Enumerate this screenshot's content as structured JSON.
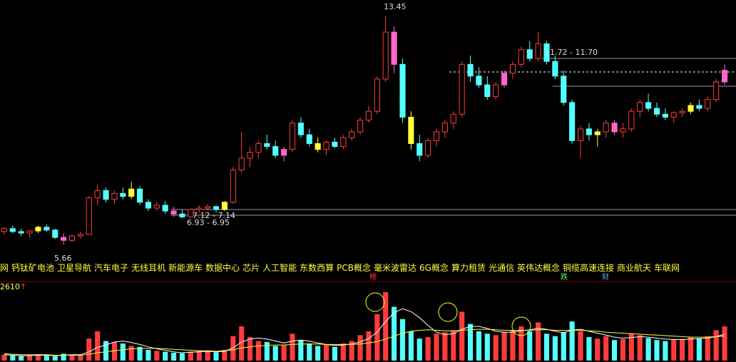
{
  "colors": {
    "background": "#000000",
    "up": "#ff3c3c",
    "down": "#54ffff",
    "highlight_yellow": "#ffff3c",
    "highlight_pink": "#ff66cc",
    "dash_line": "#ffffff",
    "concept_text": "#ffff3c",
    "ma_line": "#ffff3c",
    "ma_line2": "#ffffff"
  },
  "price_annotations": {
    "high": "13.45",
    "low": "5.66",
    "range_top": "11.72 - 11.70",
    "range_mid1": "7.12 - 7.14",
    "range_mid2": "6.93 - 6.95"
  },
  "concepts": [
    "网",
    "钙钛矿电池",
    "卫星导航",
    "汽车电子",
    "无线耳机",
    "新能源车",
    "数据中心",
    "芯片",
    "人工智能",
    "东数西算",
    "PCB概念",
    "毫米波雷达",
    "6G概念",
    "算力租赁",
    "光通信",
    "英伟达概念",
    "铜缆高速连接",
    "商业航天",
    "车联网"
  ],
  "volume_label": "2610",
  "volume_arrow": "↑",
  "event_tags": [
    {
      "text": "榜",
      "color": "#ff3c3c"
    },
    {
      "text": "跌",
      "color": "#54ff54"
    },
    {
      "text": "财",
      "color": "#54a8ff"
    }
  ],
  "chart_data": {
    "type": "candlestick",
    "title": "",
    "xlabel": "",
    "ylabel": "",
    "ylim": [
      5.2,
      13.8
    ],
    "candles": [
      [
        6.1,
        6.25,
        6.0,
        6.2
      ],
      [
        6.2,
        6.3,
        6.05,
        6.1
      ],
      [
        6.1,
        6.2,
        5.95,
        6.05
      ],
      [
        6.05,
        6.15,
        5.9,
        6.12
      ],
      [
        6.12,
        6.3,
        6.05,
        6.25
      ],
      [
        6.25,
        6.35,
        6.1,
        6.15
      ],
      [
        6.15,
        6.2,
        5.85,
        5.9
      ],
      [
        5.9,
        6.05,
        5.66,
        5.8
      ],
      [
        5.8,
        6.0,
        5.75,
        5.95
      ],
      [
        5.95,
        6.1,
        5.85,
        6.0
      ],
      [
        6.0,
        7.3,
        5.98,
        7.25
      ],
      [
        7.25,
        7.7,
        7.0,
        7.5
      ],
      [
        7.5,
        7.6,
        7.1,
        7.2
      ],
      [
        7.2,
        7.5,
        7.05,
        7.4
      ],
      [
        7.4,
        7.6,
        7.2,
        7.3
      ],
      [
        7.3,
        7.8,
        7.2,
        7.55
      ],
      [
        7.55,
        7.65,
        7.0,
        7.1
      ],
      [
        7.1,
        7.2,
        6.8,
        6.9
      ],
      [
        6.9,
        7.1,
        6.8,
        7.0
      ],
      [
        7.0,
        7.15,
        6.7,
        6.8
      ],
      [
        6.8,
        6.95,
        6.6,
        6.7
      ],
      [
        6.7,
        6.85,
        6.55,
        6.6
      ],
      [
        6.6,
        6.9,
        6.58,
        6.85
      ],
      [
        6.85,
        7.0,
        6.75,
        6.9
      ],
      [
        6.9,
        7.05,
        6.8,
        6.95
      ],
      [
        6.95,
        7.0,
        6.75,
        6.85
      ],
      [
        6.85,
        7.14,
        6.8,
        7.1
      ],
      [
        7.1,
        8.3,
        7.05,
        8.2
      ],
      [
        8.2,
        9.5,
        8.1,
        8.6
      ],
      [
        8.6,
        9.0,
        8.3,
        8.8
      ],
      [
        8.8,
        9.2,
        8.6,
        9.1
      ],
      [
        9.1,
        9.4,
        8.9,
        9.0
      ],
      [
        9.0,
        9.2,
        8.6,
        8.7
      ],
      [
        8.7,
        9.0,
        8.5,
        8.9
      ],
      [
        8.9,
        9.9,
        8.8,
        9.8
      ],
      [
        9.8,
        10.0,
        9.3,
        9.4
      ],
      [
        9.4,
        9.6,
        9.0,
        9.1
      ],
      [
        9.1,
        9.3,
        8.8,
        8.9
      ],
      [
        8.9,
        9.2,
        8.7,
        9.15
      ],
      [
        9.15,
        9.3,
        8.95,
        9.0
      ],
      [
        9.0,
        9.4,
        8.9,
        9.3
      ],
      [
        9.3,
        9.6,
        9.2,
        9.5
      ],
      [
        9.5,
        10.0,
        9.4,
        9.9
      ],
      [
        9.9,
        10.4,
        9.8,
        10.2
      ],
      [
        10.2,
        11.4,
        10.1,
        11.3
      ],
      [
        11.3,
        13.45,
        11.2,
        12.9
      ],
      [
        12.9,
        13.1,
        11.5,
        11.8
      ],
      [
        11.8,
        12.0,
        9.8,
        10.0
      ],
      [
        10.0,
        10.2,
        8.9,
        9.1
      ],
      [
        9.1,
        9.4,
        8.5,
        8.7
      ],
      [
        8.7,
        9.3,
        8.6,
        9.2
      ],
      [
        9.2,
        9.6,
        9.0,
        9.5
      ],
      [
        9.5,
        9.9,
        9.3,
        9.8
      ],
      [
        9.8,
        10.2,
        9.6,
        10.1
      ],
      [
        10.1,
        11.9,
        10.0,
        11.8
      ],
      [
        11.8,
        12.1,
        11.2,
        11.4
      ],
      [
        11.4,
        11.7,
        11.0,
        11.1
      ],
      [
        11.1,
        11.4,
        10.6,
        10.7
      ],
      [
        10.7,
        11.2,
        10.6,
        11.1
      ],
      [
        11.1,
        11.6,
        11.0,
        11.5
      ],
      [
        11.5,
        11.9,
        11.3,
        11.8
      ],
      [
        11.8,
        12.4,
        11.7,
        12.3
      ],
      [
        12.3,
        12.6,
        11.9,
        12.0
      ],
      [
        12.0,
        12.9,
        11.9,
        12.5
      ],
      [
        12.5,
        12.6,
        11.8,
        11.9
      ],
      [
        11.9,
        12.1,
        11.3,
        11.4
      ],
      [
        11.4,
        11.6,
        10.4,
        10.5
      ],
      [
        10.5,
        10.6,
        9.1,
        9.2
      ],
      [
        9.2,
        9.7,
        8.6,
        9.6
      ],
      [
        9.6,
        9.8,
        9.2,
        9.4
      ],
      [
        9.4,
        9.6,
        9.0,
        9.5
      ],
      [
        9.5,
        9.9,
        9.3,
        9.8
      ],
      [
        9.8,
        9.9,
        9.4,
        9.5
      ],
      [
        9.5,
        9.8,
        9.3,
        9.6
      ],
      [
        9.6,
        10.3,
        9.5,
        10.2
      ],
      [
        10.2,
        10.6,
        10.0,
        10.5
      ],
      [
        10.5,
        10.8,
        10.2,
        10.3
      ],
      [
        10.3,
        10.5,
        10.0,
        10.1
      ],
      [
        10.1,
        10.3,
        9.9,
        10.0
      ],
      [
        10.0,
        10.2,
        9.8,
        10.15
      ],
      [
        10.15,
        10.3,
        10.0,
        10.2
      ],
      [
        10.2,
        10.5,
        10.1,
        10.4
      ],
      [
        10.4,
        10.6,
        10.2,
        10.3
      ],
      [
        10.3,
        10.7,
        10.2,
        10.6
      ],
      [
        10.6,
        11.3,
        10.5,
        11.2
      ],
      [
        11.2,
        11.8,
        11.1,
        11.6
      ]
    ],
    "volume": [
      12,
      10,
      9,
      11,
      13,
      10,
      9,
      14,
      12,
      11,
      45,
      60,
      40,
      38,
      35,
      30,
      28,
      22,
      20,
      18,
      16,
      15,
      18,
      20,
      19,
      17,
      22,
      50,
      70,
      48,
      40,
      38,
      30,
      32,
      55,
      42,
      35,
      30,
      33,
      28,
      35,
      40,
      52,
      60,
      95,
      140,
      110,
      85,
      60,
      45,
      48,
      55,
      58,
      62,
      100,
      75,
      60,
      55,
      52,
      58,
      62,
      70,
      60,
      78,
      55,
      50,
      58,
      80,
      60,
      48,
      45,
      50,
      42,
      44,
      55,
      52,
      46,
      42,
      40,
      42,
      44,
      48,
      46,
      50,
      62,
      70
    ],
    "ma_short": [
      12,
      11,
      10,
      10,
      11,
      11,
      10,
      11,
      12,
      12,
      18,
      27,
      32,
      38,
      40,
      37,
      33,
      28,
      24,
      21,
      18,
      16,
      17,
      18,
      19,
      18,
      19,
      26,
      38,
      44,
      46,
      44,
      40,
      36,
      40,
      42,
      40,
      36,
      33,
      31,
      32,
      34,
      38,
      45,
      58,
      80,
      98,
      106,
      100,
      88,
      72,
      58,
      53,
      55,
      64,
      70,
      70,
      66,
      60,
      58,
      58,
      61,
      63,
      66,
      64,
      60,
      57,
      62,
      64,
      60,
      56,
      52,
      48,
      46,
      47,
      49,
      48,
      46,
      44,
      43,
      43,
      44,
      45,
      46,
      49,
      54
    ],
    "ma_long": [
      14,
      13,
      12,
      12,
      12,
      12,
      11,
      11,
      11,
      11,
      13,
      16,
      18,
      20,
      22,
      24,
      25,
      25,
      25,
      24,
      23,
      22,
      21,
      20,
      20,
      19,
      20,
      22,
      26,
      28,
      30,
      31,
      32,
      32,
      33,
      34,
      34,
      34,
      33,
      33,
      33,
      33,
      34,
      36,
      39,
      44,
      50,
      56,
      60,
      62,
      63,
      62,
      61,
      61,
      62,
      63,
      64,
      64,
      63,
      62,
      62,
      62,
      62,
      63,
      63,
      62,
      62,
      62,
      62,
      61,
      60,
      58,
      57,
      56,
      55,
      54,
      53,
      52,
      51,
      50,
      49,
      48,
      48,
      48,
      49,
      50
    ]
  }
}
